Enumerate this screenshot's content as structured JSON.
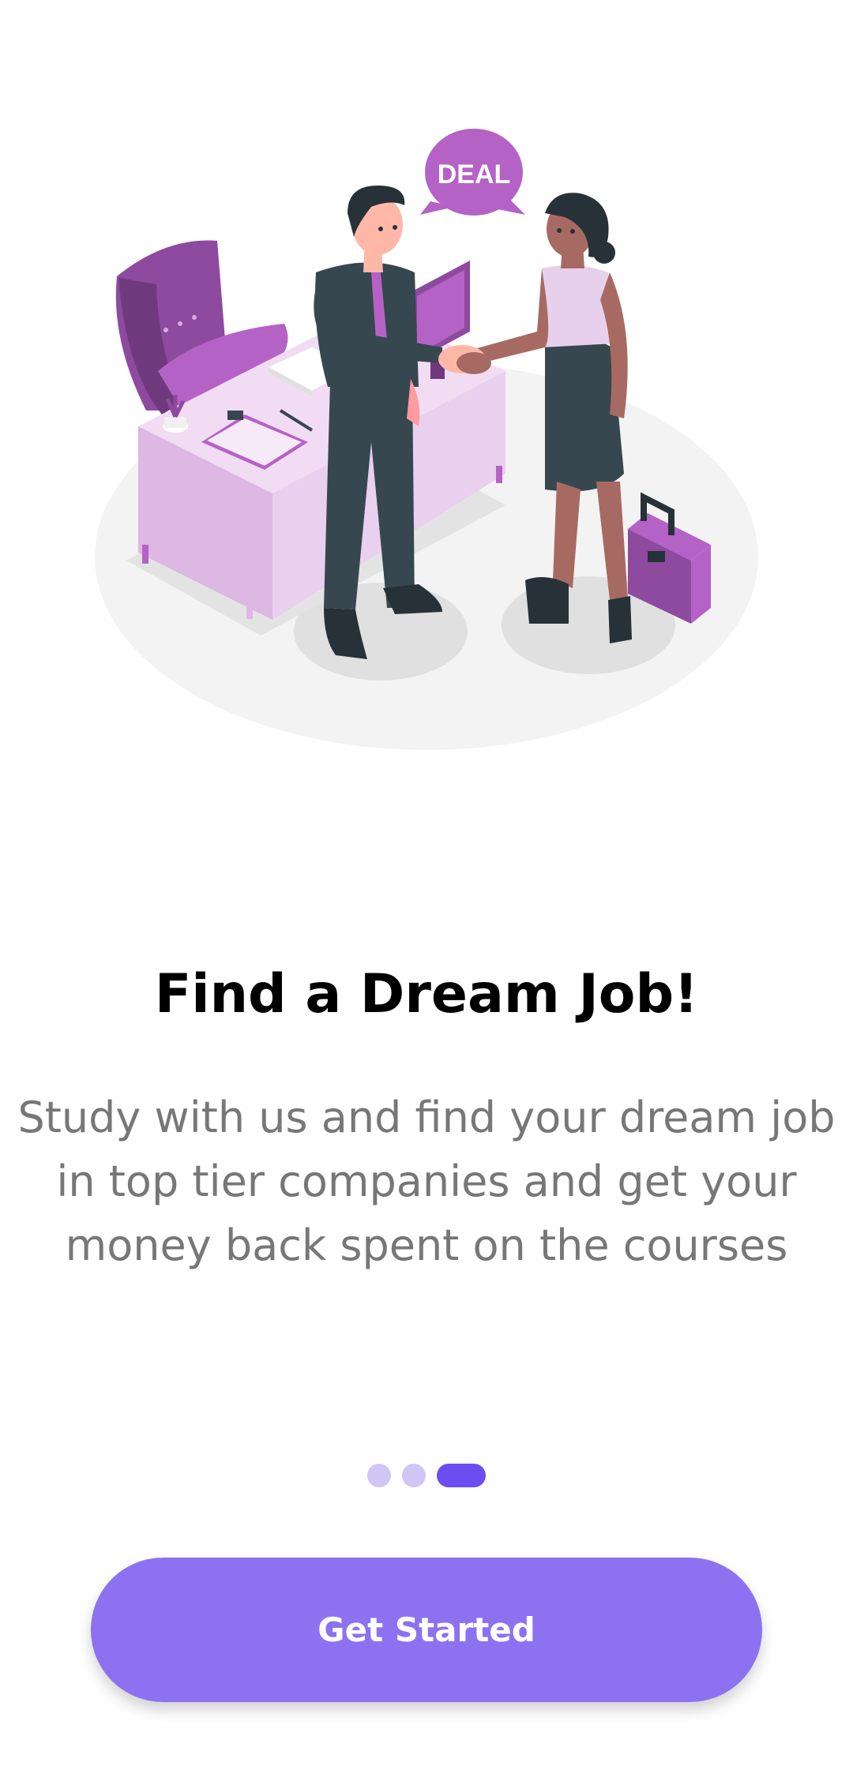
{
  "illustration": {
    "speech_bubble_text": "DEAL"
  },
  "onboarding": {
    "title": "Find a Dream Job!",
    "description": "Study with us and find your dream job in top tier companies and get your money back spent on the courses",
    "pager": {
      "total_pages": 3,
      "current_page": 3
    },
    "cta_label": "Get Started"
  },
  "colors": {
    "accent": "#8C72F1",
    "pager_active": "#6C4EF0",
    "pager_inactive": "#CFC6F6",
    "illustration_purple": "#B562C6",
    "text_primary": "#000000",
    "text_secondary": "#777777"
  }
}
